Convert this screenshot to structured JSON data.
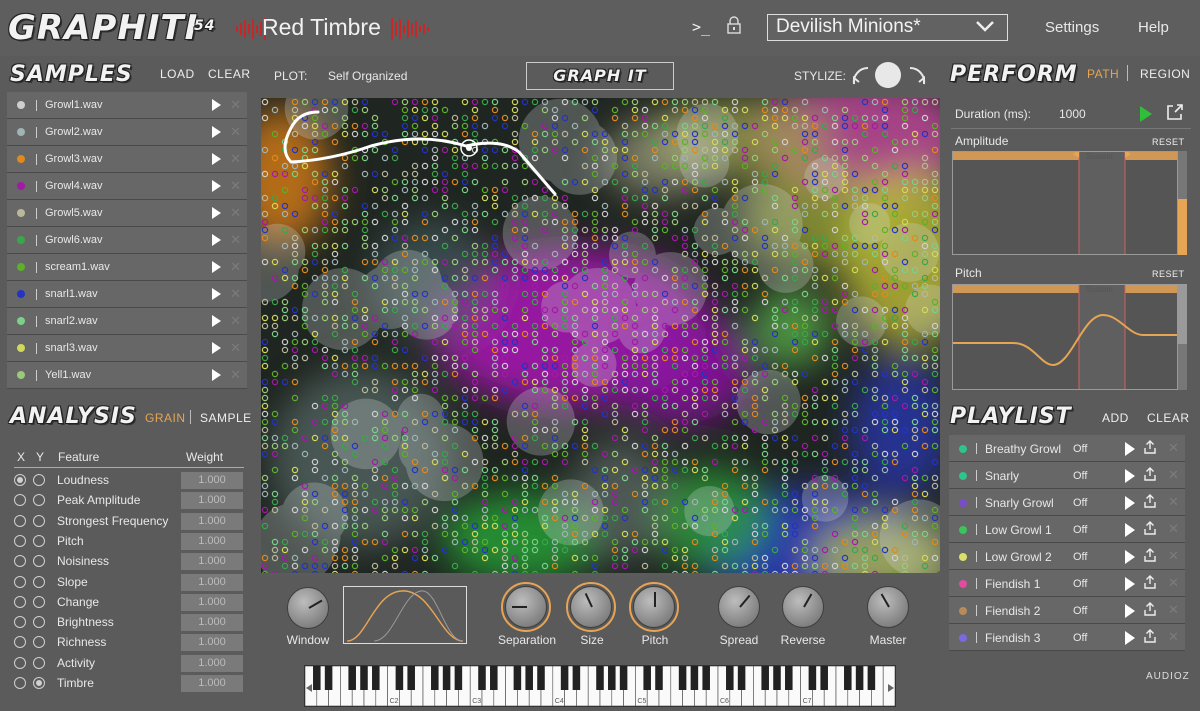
{
  "header": {
    "logo": "GRAPHITI",
    "version": "54",
    "brand": "Red Timbre",
    "terminal_icon": ">_",
    "preset": "Devilish Minions*",
    "settings": "Settings",
    "help": "Help"
  },
  "samples": {
    "title": "SAMPLES",
    "load": "LOAD",
    "clear": "CLEAR",
    "items": [
      {
        "name": "Growl1.wav",
        "color": "#cfcfcf"
      },
      {
        "name": "Growl2.wav",
        "color": "#9fb4b4"
      },
      {
        "name": "Growl3.wav",
        "color": "#e08a1e"
      },
      {
        "name": "Growl4.wav",
        "color": "#a21aa6"
      },
      {
        "name": "Growl5.wav",
        "color": "#b9b99a"
      },
      {
        "name": "Growl6.wav",
        "color": "#3aa64a"
      },
      {
        "name": "scream1.wav",
        "color": "#5cb02a"
      },
      {
        "name": "snarl1.wav",
        "color": "#2433c4"
      },
      {
        "name": "snarl2.wav",
        "color": "#7cd08a"
      },
      {
        "name": "snarl3.wav",
        "color": "#d3d85a"
      },
      {
        "name": "Yell1.wav",
        "color": "#9bc97a"
      }
    ]
  },
  "analysis": {
    "title": "ANALYSIS",
    "grain": "GRAIN",
    "sample": "SAMPLE",
    "col_x": "X",
    "col_y": "Y",
    "col_feature": "Feature",
    "col_weight": "Weight",
    "features": [
      {
        "name": "Loudness",
        "weight": "1.000",
        "x": true,
        "y": false
      },
      {
        "name": "Peak Amplitude",
        "weight": "1.000",
        "x": false,
        "y": false
      },
      {
        "name": "Strongest Frequency",
        "weight": "1.000",
        "x": false,
        "y": false
      },
      {
        "name": "Pitch",
        "weight": "1.000",
        "x": false,
        "y": false
      },
      {
        "name": "Noisiness",
        "weight": "1.000",
        "x": false,
        "y": false
      },
      {
        "name": "Slope",
        "weight": "1.000",
        "x": false,
        "y": false
      },
      {
        "name": "Change",
        "weight": "1.000",
        "x": false,
        "y": false
      },
      {
        "name": "Brightness",
        "weight": "1.000",
        "x": false,
        "y": false
      },
      {
        "name": "Richness",
        "weight": "1.000",
        "x": false,
        "y": false
      },
      {
        "name": "Activity",
        "weight": "1.000",
        "x": false,
        "y": false
      },
      {
        "name": "Timbre",
        "weight": "1.000",
        "x": false,
        "y": true
      }
    ]
  },
  "plot": {
    "label": "PLOT:",
    "value": "Self Organized",
    "graph_it": "GRAPH IT",
    "stylize": "STYLIZE:"
  },
  "controls": {
    "window": "Window",
    "separation": "Separation",
    "size": "Size",
    "pitch": "Pitch",
    "spread": "Spread",
    "reverse": "Reverse",
    "master": "Master",
    "octaves": [
      "C2",
      "C3",
      "C4",
      "C5",
      "C6",
      "C7"
    ]
  },
  "perform": {
    "title": "PERFORM",
    "path": "PATH",
    "region": "REGION",
    "duration_label": "Duration (ms):",
    "duration_value": "1000",
    "amplitude": "Amplitude",
    "pitch": "Pitch",
    "reset": "RESET",
    "sustain": "Sustain"
  },
  "playlist": {
    "title": "PLAYLIST",
    "add": "ADD",
    "clear": "CLEAR",
    "items": [
      {
        "name": "Breathy Growl",
        "state": "Off",
        "color": "#2ec48c"
      },
      {
        "name": "Snarly",
        "state": "Off",
        "color": "#2ec48c"
      },
      {
        "name": "Snarly Growl",
        "state": "Off",
        "color": "#7a4cc8"
      },
      {
        "name": "Low Growl 1",
        "state": "Off",
        "color": "#3bc45a"
      },
      {
        "name": "Low Growl 2",
        "state": "Off",
        "color": "#dbe06a"
      },
      {
        "name": "Fiendish 1",
        "state": "Off",
        "color": "#e04ca0"
      },
      {
        "name": "Fiendish 2",
        "state": "Off",
        "color": "#b88c58"
      },
      {
        "name": "Fiendish 3",
        "state": "Off",
        "color": "#7a6ae0"
      }
    ]
  },
  "watermark": "AUDIOZ",
  "accent": "#e6a455"
}
